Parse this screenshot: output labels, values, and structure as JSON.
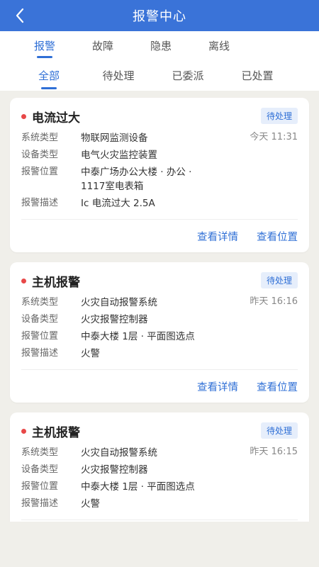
{
  "header": {
    "title": "报警中心",
    "back_icon": "chevron-left-icon"
  },
  "main_tabs": [
    {
      "label": "报警",
      "active": true
    },
    {
      "label": "故障",
      "active": false
    },
    {
      "label": "隐患",
      "active": false
    },
    {
      "label": "离线",
      "active": false
    }
  ],
  "sub_tabs": [
    {
      "label": "全部",
      "active": true
    },
    {
      "label": "待处理",
      "active": false
    },
    {
      "label": "已委派",
      "active": false
    },
    {
      "label": "已处置",
      "active": false
    }
  ],
  "labels": {
    "system_type": "系统类型",
    "device_type": "设备类型",
    "location": "报警位置",
    "description": "报警描述"
  },
  "actions": {
    "details": "查看详情",
    "location": "查看位置"
  },
  "alarms": [
    {
      "title": "电流过大",
      "status": "待处理",
      "time": "今天 11:31",
      "system_type": "物联网监测设备",
      "device_type": "电气火灾监控装置",
      "location": "中泰广场办公大楼 · 办公 · 1117室电表箱",
      "description": "Ic 电流过大 2.5A"
    },
    {
      "title": "主机报警",
      "status": "待处理",
      "time": "昨天 16:16",
      "system_type": "火灾自动报警系统",
      "device_type": "火灾报警控制器",
      "location": "中泰大楼 1层 · 平面图选点",
      "description": "火警"
    },
    {
      "title": "主机报警",
      "status": "待处理",
      "time": "昨天 16:15",
      "system_type": "火灾自动报警系统",
      "device_type": "火灾报警控制器",
      "location": "中泰大楼 1层 · 平面图选点",
      "description": "火警"
    }
  ],
  "colors": {
    "primary": "#3a73d8",
    "accent": "#2f6fd6",
    "alert_dot": "#e84848",
    "badge_bg": "#e6eefb",
    "page_bg": "#f0efea"
  }
}
